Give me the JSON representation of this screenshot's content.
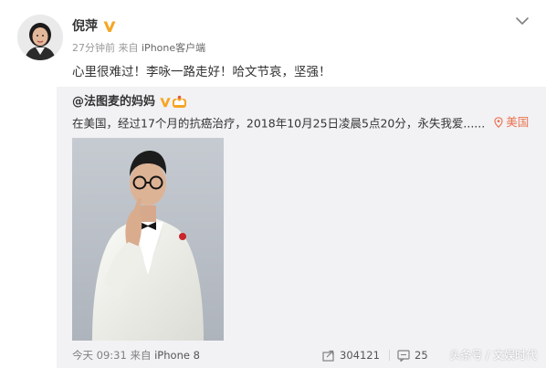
{
  "post": {
    "author_name": "倪萍",
    "time": "27分钟前",
    "source_prefix": "来自",
    "source_device": "iPhone客户端",
    "text": "心里很难过！李咏一路走好！哈文节哀，坚强！",
    "avatar_icon": "user-avatar-photo",
    "verified_icon": "verified-v-badge",
    "expand_icon": "chevron-down-icon"
  },
  "repost": {
    "author": "@法图麦的妈妈",
    "text": "在美国，经过17个月的抗癌治疗，2018年10月25日凌晨5点20分，永失我爱......",
    "location": "美国",
    "location_icon": "location-pin-icon",
    "footer": {
      "time": "今天 09:31",
      "source_prefix": "来自",
      "source_device": "iPhone 8",
      "share_count": "304121",
      "comment_count": "25"
    }
  },
  "watermark": {
    "text": "头条号 / 文娱时代"
  },
  "colors": {
    "background": "#ffffff",
    "repost_background": "#f2f2f5",
    "location_orange": "#eb7350",
    "verified_orange": "#f5a623",
    "meta_gray": "#999999"
  }
}
